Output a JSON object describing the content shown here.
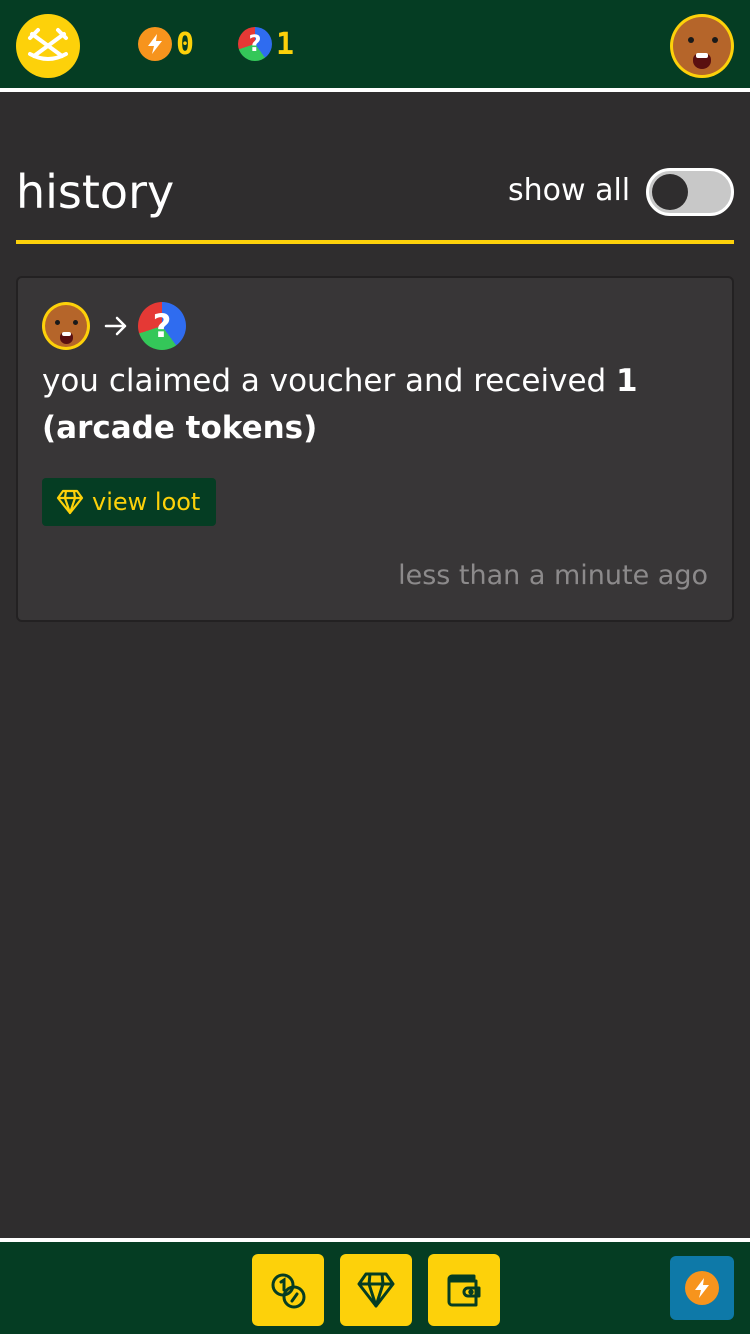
{
  "header": {
    "energy_count": "0",
    "token_count": "1",
    "token_glyph": "?"
  },
  "history": {
    "title": "history",
    "show_all_label": "show all",
    "show_all_enabled": false
  },
  "entries": [
    {
      "message_prefix": "you claimed a voucher and received ",
      "message_bold": "1 (arcade tokens)",
      "action_label": "view loot",
      "timestamp": "less than a minute ago",
      "from_icon": "avatar-icon",
      "to_icon": "arcade-token-icon"
    }
  ],
  "bottom_nav": {
    "items": [
      "coins-icon",
      "diamond-icon",
      "wallet-icon"
    ],
    "fab_icon": "lightning-icon"
  },
  "colors": {
    "header_bg": "#053d23",
    "accent_yellow": "#fdd10a",
    "page_bg": "#2f2d2e",
    "card_bg": "#383637",
    "energy_orange": "#f7941d",
    "fab_blue": "#0e79a8"
  }
}
